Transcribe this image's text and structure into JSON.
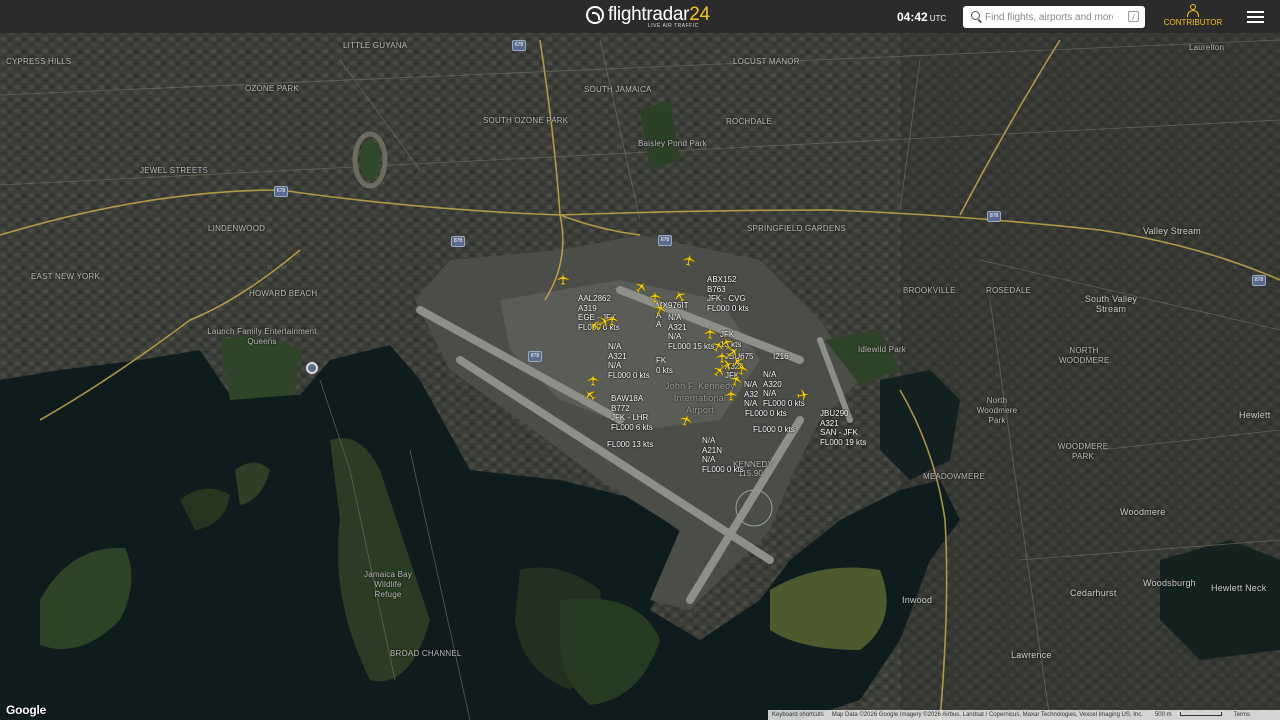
{
  "header": {
    "logo_text": "flightradar",
    "logo_number": "24",
    "logo_tagline": "LIVE AIR TRAFFIC",
    "time": "04:42",
    "time_zone": "UTC",
    "search_placeholder": "Find flights, airports and more",
    "search_shortcut": "/",
    "contributor_label": "CONTRIBUTOR"
  },
  "map": {
    "places": [
      "LITTLE GUYANA",
      "CYPRESS HILLS",
      "OZONE PARK",
      "SOUTH JAMAICA",
      "LOCUST MANOR",
      "SOUTH OZONE PARK",
      "ROCHDALE",
      "Baisley Pond Park",
      "JEWEL STREETS",
      "LINDENWOOD",
      "SPRINGFIELD GARDENS",
      "EAST NEW YORK",
      "HOWARD BEACH",
      "Launch Family Entertainment Queens",
      "BROOKVILLE",
      "ROSEDALE",
      "Valley Stream",
      "South Valley Stream",
      "Idlewild Park",
      "NORTH WOODMERE",
      "North Woodmere Park",
      "WOODMERE PARK",
      "Hewlett",
      "MEADOWMERE",
      "Woodmere",
      "Woodsburgh",
      "Hewlett Neck",
      "Cedarhurst",
      "Inwood",
      "Lawrence",
      "Jamaica Bay Wildlife Refuge",
      "BROAD CHANNEL",
      "Laurelton",
      "John F. Kennedy International Airport",
      "KENNEDY",
      "115.90"
    ],
    "shields": [
      "678",
      "678",
      "878",
      "678",
      "878",
      "878",
      "878"
    ],
    "flights": [
      [
        "AAL2862",
        "A319",
        "EGE - JFK",
        "FL000 0 kts"
      ],
      [
        "ABX152",
        "B763",
        "JFK - CVG",
        "FL000 0 kts"
      ],
      [
        "MX976IT",
        "A",
        "A"
      ],
      [
        "N/A",
        "A321",
        "N/A",
        "FL000 15 kts"
      ],
      [
        "JFK",
        "13 kts"
      ],
      [
        "N/A",
        "A321",
        "N/A",
        "FL000 0 kts"
      ],
      [
        "FK",
        "0 kts"
      ],
      [
        "JBU675",
        "A320",
        "JFK"
      ],
      [
        "I216"
      ],
      [
        "N/A",
        "A320",
        "N/A",
        "FL000 0 kts"
      ],
      [
        "N/A",
        "A32",
        "N/A"
      ],
      [
        "FL000 0 kts"
      ],
      [
        "BAW18A",
        "B772",
        "JFK - LHR",
        "FL000 6 kts"
      ],
      [
        "FL000 13 kts"
      ],
      [
        "JBU290",
        "A321",
        "SAN - JFK",
        "FL000 19 kts"
      ],
      [
        "FL000 0 kts"
      ],
      [
        "N/A",
        "A21N",
        "N/A",
        "FL000 0 kts"
      ]
    ],
    "aircraft_icon": "airplane-icon",
    "aircraft_color": "#f5d10a"
  },
  "footer": {
    "google_logo": "Google",
    "keyboard_shortcuts": "Keyboard shortcuts",
    "map_data": "Map Data ©2026 Google Imagery ©2026 Airbus, Landsat / Copernicus, Maxar Technologies, Vexcel Imaging US, Inc.",
    "scale": "500 m",
    "terms": "Terms"
  },
  "colors": {
    "topbar": "#2b2b2b",
    "accent": "#f5c518",
    "water": "#0f1c1e"
  }
}
